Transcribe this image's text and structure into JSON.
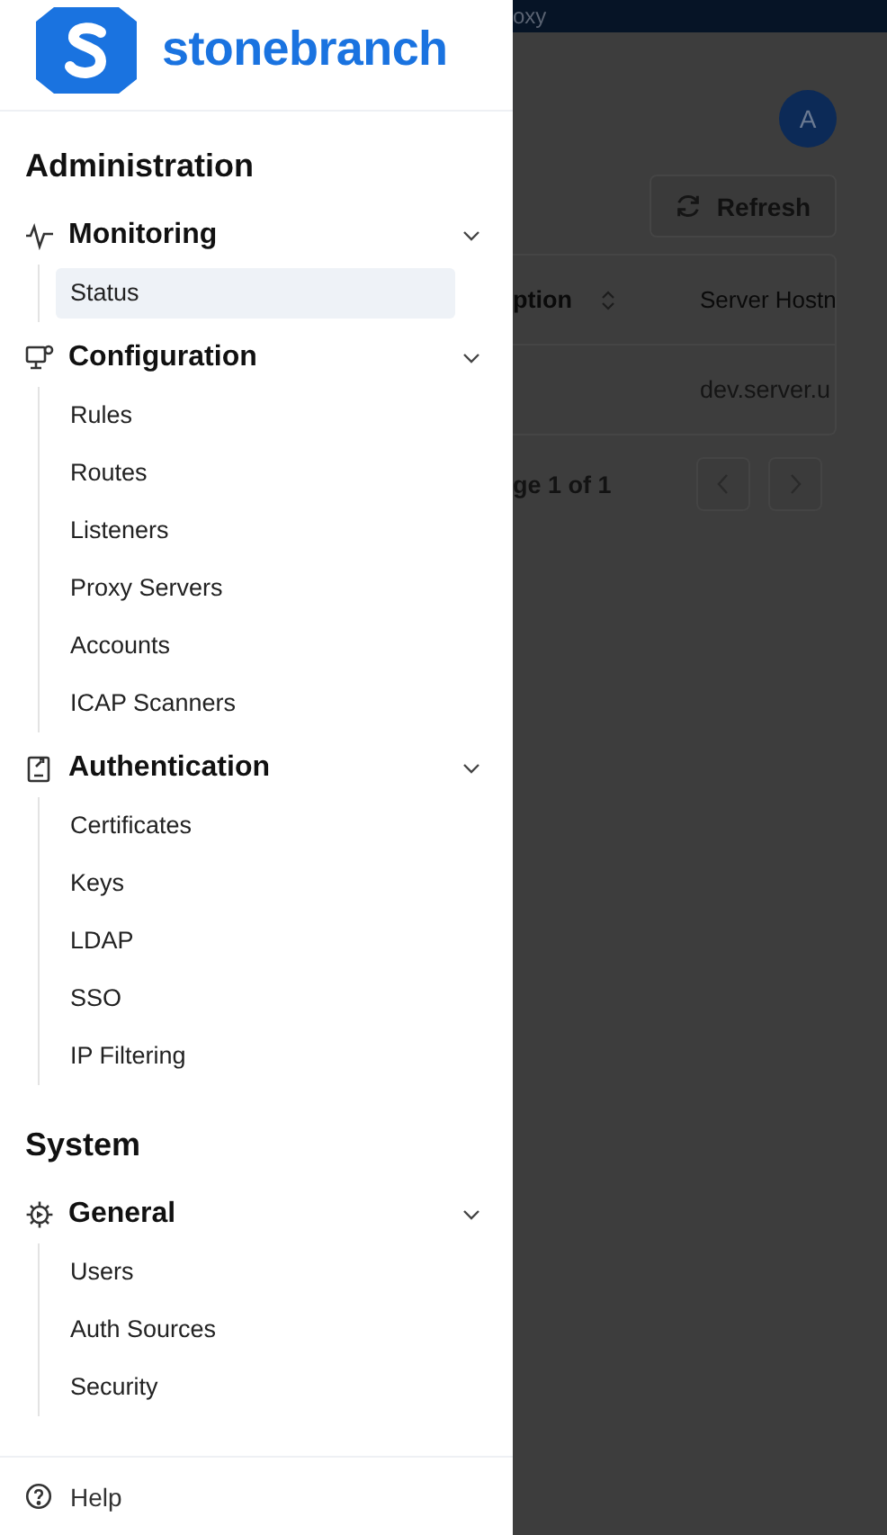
{
  "sidebar": {
    "logo": {
      "text": "stonebranch"
    },
    "sections": [
      {
        "title": "Administration",
        "groups": [
          {
            "label": "Monitoring",
            "expanded": true,
            "items": [
              {
                "label": "Status",
                "selected": true
              }
            ]
          },
          {
            "label": "Configuration",
            "expanded": true,
            "items": [
              {
                "label": "Rules",
                "selected": false
              },
              {
                "label": "Routes",
                "selected": false
              },
              {
                "label": "Listeners",
                "selected": false
              },
              {
                "label": "Proxy Servers",
                "selected": false
              },
              {
                "label": "Accounts",
                "selected": false
              },
              {
                "label": "ICAP Scanners",
                "selected": false
              }
            ]
          },
          {
            "label": "Authentication",
            "expanded": true,
            "items": [
              {
                "label": "Certificates",
                "selected": false
              },
              {
                "label": "Keys",
                "selected": false
              },
              {
                "label": "LDAP",
                "selected": false
              },
              {
                "label": "SSO",
                "selected": false
              },
              {
                "label": "IP Filtering",
                "selected": false
              }
            ]
          }
        ]
      },
      {
        "title": "System",
        "groups": [
          {
            "label": "General",
            "expanded": true,
            "items": [
              {
                "label": "Users",
                "selected": false
              },
              {
                "label": "Auth Sources",
                "selected": false
              },
              {
                "label": "Security",
                "selected": false
              }
            ]
          }
        ]
      }
    ],
    "help": "Help"
  },
  "background": {
    "top_bar_text": "oxy",
    "avatar": "A",
    "refresh_button": "Refresh",
    "table": {
      "columns": [
        {
          "label": "ption",
          "sortable": true
        },
        {
          "label": "Server Hostn",
          "sortable": false
        }
      ],
      "rows": [
        {
          "column_2": "dev.server.u"
        }
      ]
    },
    "pagination": "ge 1 of 1"
  }
}
